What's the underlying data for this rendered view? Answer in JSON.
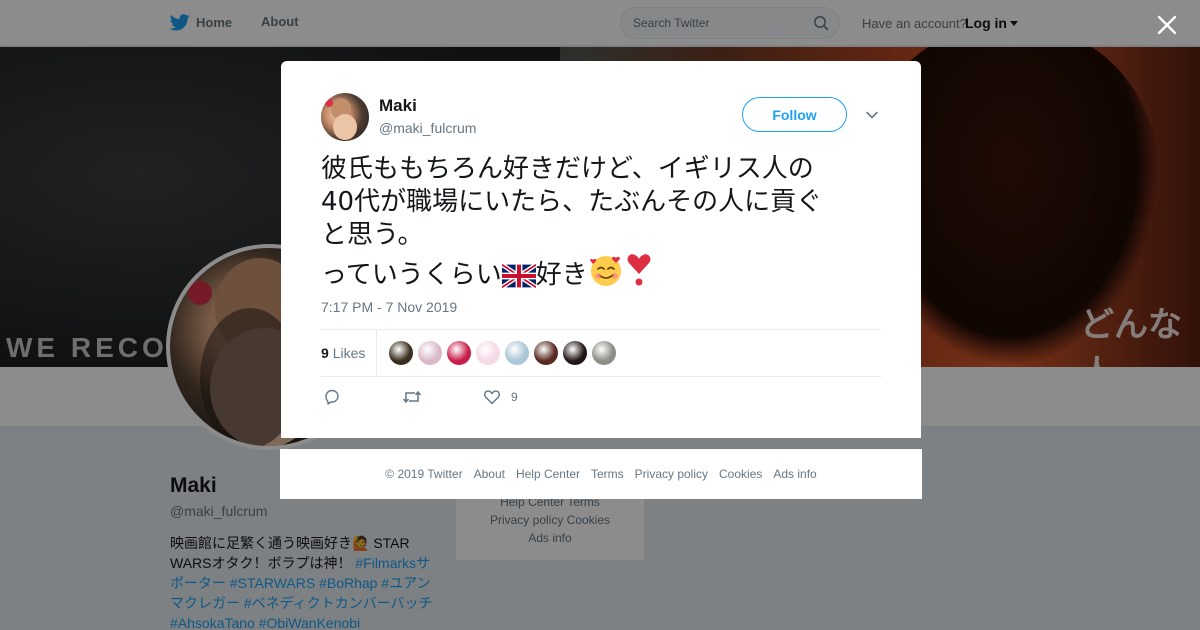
{
  "topbar": {
    "home_label": "Home",
    "about_label": "About",
    "search_placeholder": "Search Twitter",
    "have_account": "Have an account?",
    "login_label": "Log in"
  },
  "banner": {
    "text_left": "WE RECOM",
    "text_right": "どんな人"
  },
  "profile": {
    "name": "Maki",
    "handle": "@maki_fulcrum",
    "bio_plain": "映画館に足繁く通う映画好き🙋 STAR WARSオタク！ボラプは神！",
    "bio_tags": "#Filmarksサポーター #STARWARS #BoRhap #ユアンマクレガー #ベネディクトカンバーバッチ #AhsokaTano #ObiWanKenobi"
  },
  "side_footer": {
    "line1": "Help Center   Terms",
    "line2": "Privacy policy   Cookies",
    "line3": "Ads info"
  },
  "tweet": {
    "author_name": "Maki",
    "author_handle": "@maki_fulcrum",
    "follow_label": "Follow",
    "text_line1": "彼氏ももちろん好きだけど、イギリス人の",
    "text_line2": "40代が職場にいたら、たぶんその人に貢ぐ",
    "text_line3": "と思う。",
    "text_line4_a": "っていうくらい",
    "text_line4_b": "好き",
    "timestamp": "7:17 PM - 7 Nov 2019",
    "likes_number": "9",
    "likes_label": "Likes",
    "like_action_count": "9",
    "liker_colors": [
      "#3a2e1e",
      "#d9b9c8",
      "#c81f4a",
      "#f4d9e6",
      "#a9c7d6",
      "#5a2a22",
      "#241717",
      "#8a8e84"
    ]
  },
  "footer": {
    "links": [
      "© 2019 Twitter",
      "About",
      "Help Center",
      "Terms",
      "Privacy policy",
      "Cookies",
      "Ads info"
    ]
  },
  "colors": {
    "accent": "#1da1f2",
    "muted": "#657786",
    "text": "#14171a"
  },
  "icons": [
    "twitter-bird-icon",
    "search-icon",
    "caret-down-icon",
    "close-icon",
    "chevron-down-icon",
    "reply-icon",
    "retweet-icon",
    "heart-icon",
    "uk-flag-emoji",
    "smiling-hearts-emoji",
    "heart-exclamation-emoji"
  ]
}
